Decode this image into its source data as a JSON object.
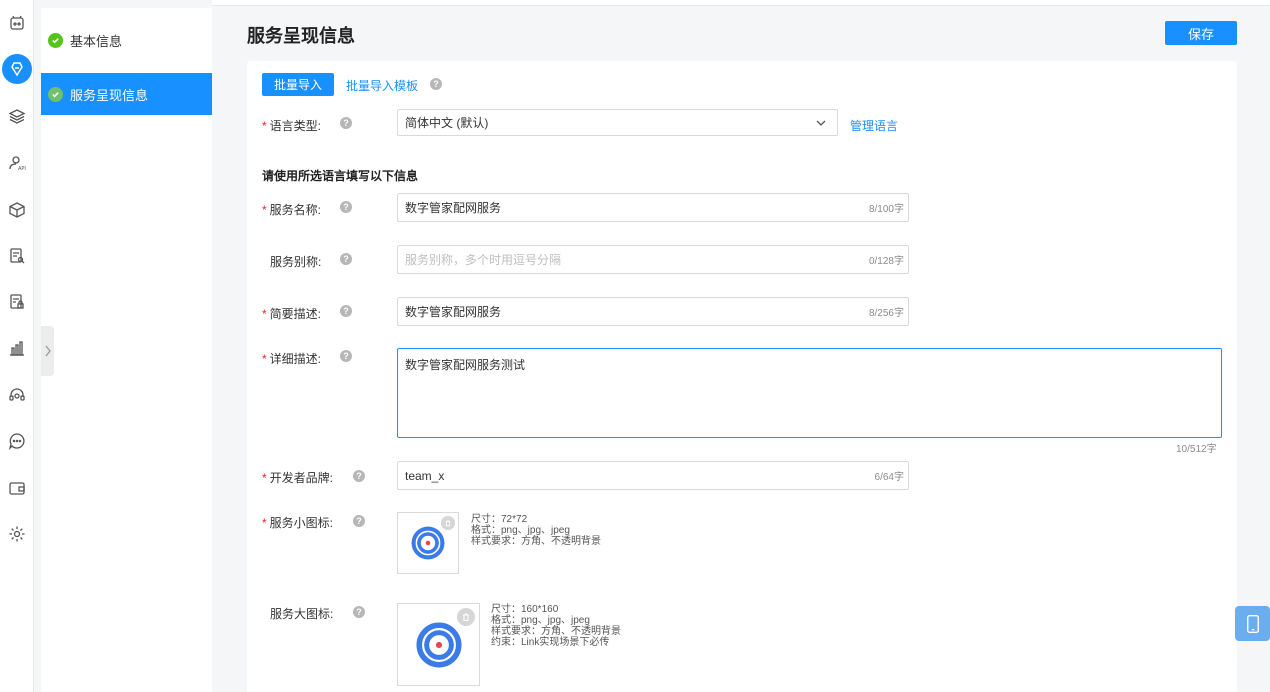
{
  "steps": [
    {
      "label": "基本信息"
    },
    {
      "label": "服务呈现信息"
    }
  ],
  "header": {
    "title": "服务呈现信息",
    "save_label": "保存"
  },
  "toolbar": {
    "import_label": "批量导入",
    "template_label": "批量导入模板"
  },
  "language": {
    "label": "语言类型:",
    "value": "简体中文 (默认)",
    "manage_label": "管理语言"
  },
  "section_title": "请使用所选语言填写以下信息",
  "fields": {
    "name": {
      "label": "服务名称:",
      "value": "数字管家配网服务",
      "count": "8/100字"
    },
    "alias": {
      "label": "服务别称:",
      "placeholder": "服务别称，多个时用逗号分隔",
      "count": "0/128字"
    },
    "brief": {
      "label": "简要描述:",
      "value": "数字管家配网服务",
      "count": "8/256字"
    },
    "detail": {
      "label": "详细描述:",
      "value": "数字管家配网服务测试",
      "count": "10/512字"
    },
    "brand": {
      "label": "开发者品牌:",
      "value": "team_x",
      "count": "6/64字"
    }
  },
  "small_icon": {
    "label": "服务小图标:",
    "hints": [
      "尺寸：72*72",
      "格式：png、jpg、jpeg",
      "样式要求：方角、不透明背景"
    ]
  },
  "large_icon": {
    "label": "服务大图标:",
    "hints": [
      "尺寸：160*160",
      "格式：png、jpg、jpeg",
      "样式要求：方角、不透明背景",
      "约束：Link实现场景下必传"
    ]
  },
  "required_mark": "*",
  "help_mark": "?",
  "colors": {
    "primary": "#1890ff",
    "success": "#52c41a",
    "required": "#f5222d",
    "logo_blue": "#3b7be8",
    "logo_red": "#e8464a"
  },
  "icons": [
    "robot-icon",
    "brand-logo-icon",
    "layers-icon",
    "user-api-icon",
    "cube-icon",
    "doc-search-icon",
    "doc-lock-icon",
    "bar-chart-icon",
    "headset-icon",
    "chat-icon",
    "wallet-icon",
    "gear-icon",
    "chevron-right-icon",
    "phone-icon",
    "trash-icon"
  ]
}
